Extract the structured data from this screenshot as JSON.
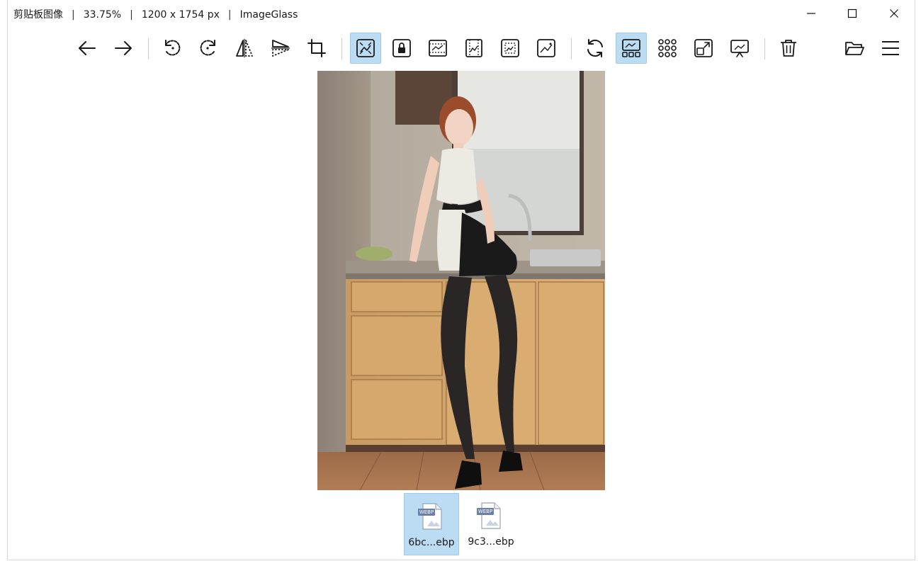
{
  "titlebar": {
    "segments": [
      "剪贴板图像",
      "33.75%",
      "1200 x 1754 px",
      "ImageGlass"
    ],
    "separator": "|"
  },
  "window_controls": [
    "minimize-icon",
    "maximize-icon",
    "close-icon"
  ],
  "toolbar": {
    "buttons": [
      {
        "icon": "arrow-left-icon",
        "active": false
      },
      {
        "icon": "arrow-right-icon",
        "active": false
      },
      {
        "icon": "rotate-left-icon",
        "active": false
      },
      {
        "icon": "rotate-right-icon",
        "active": false
      },
      {
        "icon": "flip-horizontal-icon",
        "active": false
      },
      {
        "icon": "flip-vertical-icon",
        "active": false
      },
      {
        "icon": "crop-icon",
        "active": false
      },
      {
        "icon": "auto-zoom-icon",
        "active": true
      },
      {
        "icon": "lock-zoom-icon",
        "active": false
      },
      {
        "icon": "scale-to-width-icon",
        "active": false
      },
      {
        "icon": "scale-to-height-icon",
        "active": false
      },
      {
        "icon": "scale-to-fit-icon",
        "active": false
      },
      {
        "icon": "scale-to-fill-icon",
        "active": false
      },
      {
        "icon": "refresh-icon",
        "active": false
      },
      {
        "icon": "thumbnail-bar-icon",
        "active": true
      },
      {
        "icon": "checkerboard-icon",
        "active": false
      },
      {
        "icon": "fullscreen-icon",
        "active": false
      },
      {
        "icon": "slideshow-icon",
        "active": false
      },
      {
        "icon": "delete-icon",
        "active": false
      },
      {
        "icon": "open-folder-icon",
        "active": false
      },
      {
        "icon": "menu-icon",
        "active": false
      }
    ]
  },
  "viewer": {
    "image_alt": "photo"
  },
  "thumbnails": [
    {
      "label": "6bc...ebp",
      "badge": "WEBP",
      "active": true
    },
    {
      "label": "9c3...ebp",
      "badge": "WEBP",
      "active": false
    }
  ],
  "colors": {
    "accent": "#bcdcf4",
    "accent_border": "#9fcaec"
  }
}
